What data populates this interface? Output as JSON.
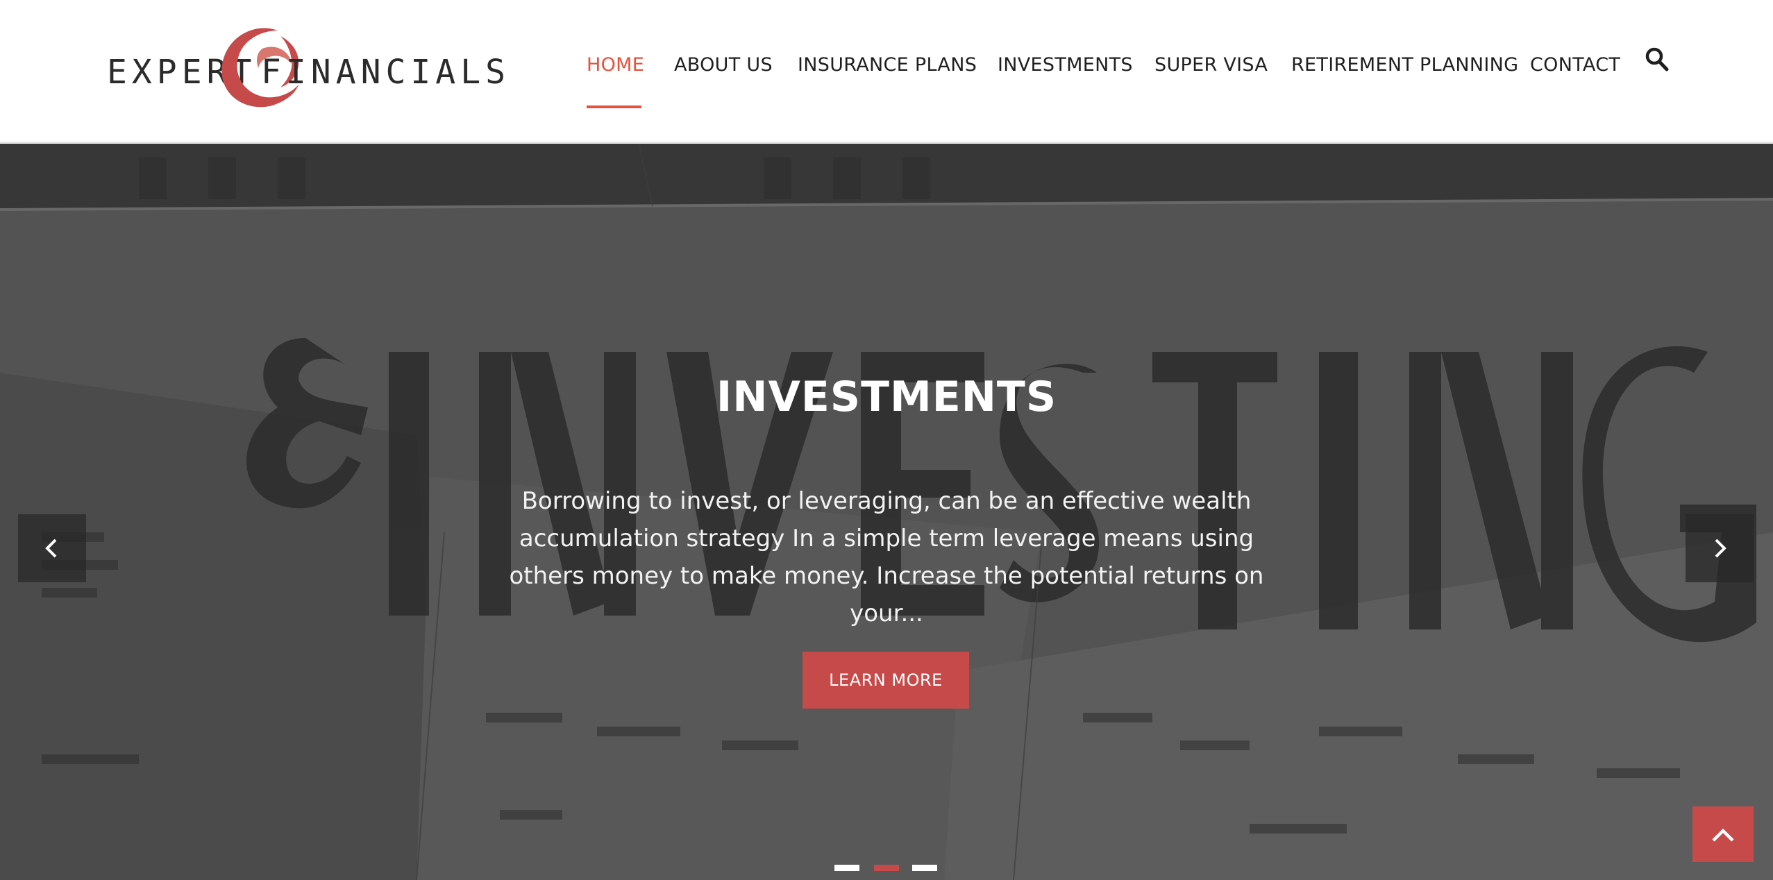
{
  "brand": {
    "left_word": "EXPERT",
    "right_word": "FINANCIALS",
    "accent_color": "#c74a4a"
  },
  "nav": {
    "items": [
      {
        "label": "HOME",
        "active": true
      },
      {
        "label": "ABOUT US",
        "active": false
      },
      {
        "label": "INSURANCE PLANS",
        "active": false
      },
      {
        "label": "INVESTMENTS",
        "active": false
      },
      {
        "label": "SUPER VISA",
        "active": false
      },
      {
        "label": "RETIREMENT PLANNING",
        "active": false
      },
      {
        "label": "CONTACT",
        "active": false
      }
    ],
    "active_color": "#e5533d",
    "search_icon": "search-icon"
  },
  "hero": {
    "title": "INVESTMENTS",
    "description": "Borrowing to invest, or leveraging, can be an effective wealth accumulation strategy In a simple term leverage means using others money to make money. Increase the potential returns on your...",
    "cta_label": "LEARN MORE",
    "prev_icon": "chevron-left-icon",
    "next_icon": "chevron-right-icon",
    "slide_count": 3,
    "active_slide": 2
  },
  "scroll_top_icon": "chevron-up-icon"
}
